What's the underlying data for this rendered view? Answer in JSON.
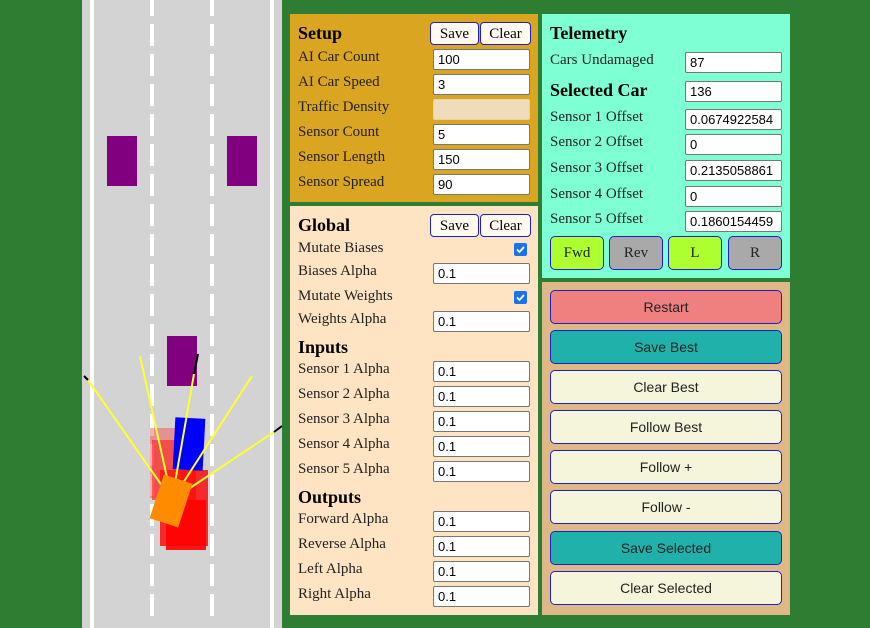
{
  "colors": {
    "background": "#2e7d32",
    "road": "#d3d3d3",
    "setup_panel": "#daa520",
    "global_panel": "#ffe4c4",
    "telemetry_panel": "#7fffd4",
    "actions_panel": "#deb887",
    "restart": "#f08080",
    "teal_button": "#20b2aa",
    "light_button": "#f5f5dc",
    "active_button": "#adff2f",
    "inactive_button": "#a9a9a9"
  },
  "setup": {
    "title": "Setup",
    "save_label": "Save",
    "clear_label": "Clear",
    "fields": [
      {
        "label": "AI Car Count",
        "value": "100"
      },
      {
        "label": "AI Car Speed",
        "value": "3"
      },
      {
        "label": "Traffic Density",
        "value": ""
      },
      {
        "label": "Sensor Count",
        "value": "5"
      },
      {
        "label": "Sensor Length",
        "value": "150"
      },
      {
        "label": "Sensor Spread",
        "value": "90"
      }
    ]
  },
  "global": {
    "title": "Global",
    "save_label": "Save",
    "clear_label": "Clear",
    "mutate_biases_label": "Mutate Biases",
    "biases_alpha_label": "Biases Alpha",
    "biases_alpha_value": "0.1",
    "mutate_weights_label": "Mutate Weights",
    "weights_alpha_label": "Weights Alpha",
    "weights_alpha_value": "0.1",
    "inputs_title": "Inputs",
    "inputs": [
      {
        "label": "Sensor 1 Alpha",
        "value": "0.1"
      },
      {
        "label": "Sensor 2 Alpha",
        "value": "0.1"
      },
      {
        "label": "Sensor 3 Alpha",
        "value": "0.1"
      },
      {
        "label": "Sensor 4 Alpha",
        "value": "0.1"
      },
      {
        "label": "Sensor 5 Alpha",
        "value": "0.1"
      }
    ],
    "outputs_title": "Outputs",
    "outputs": [
      {
        "label": "Forward Alpha",
        "value": "0.1"
      },
      {
        "label": "Reverse Alpha",
        "value": "0.1"
      },
      {
        "label": "Left Alpha",
        "value": "0.1"
      },
      {
        "label": "Right Alpha",
        "value": "0.1"
      }
    ]
  },
  "telemetry": {
    "title": "Telemetry",
    "cars_undamaged_label": "Cars Undamaged",
    "cars_undamaged_value": "87",
    "selected_car_label": "Selected Car",
    "selected_car_value": "136",
    "offsets": [
      {
        "label": "Sensor 1 Offset",
        "value": "0.0674922584"
      },
      {
        "label": "Sensor 2 Offset",
        "value": "0"
      },
      {
        "label": "Sensor 3 Offset",
        "value": "0.2135058861"
      },
      {
        "label": "Sensor 4 Offset",
        "value": "0"
      },
      {
        "label": "Sensor 5 Offset",
        "value": "0.1860154459"
      }
    ],
    "controls": [
      "Fwd",
      "Rev",
      "L",
      "R"
    ]
  },
  "actions": {
    "buttons": [
      "Restart",
      "Save Best",
      "Clear Best",
      "Follow Best",
      "Follow +",
      "Follow -",
      "Save Selected",
      "Clear Selected"
    ]
  }
}
